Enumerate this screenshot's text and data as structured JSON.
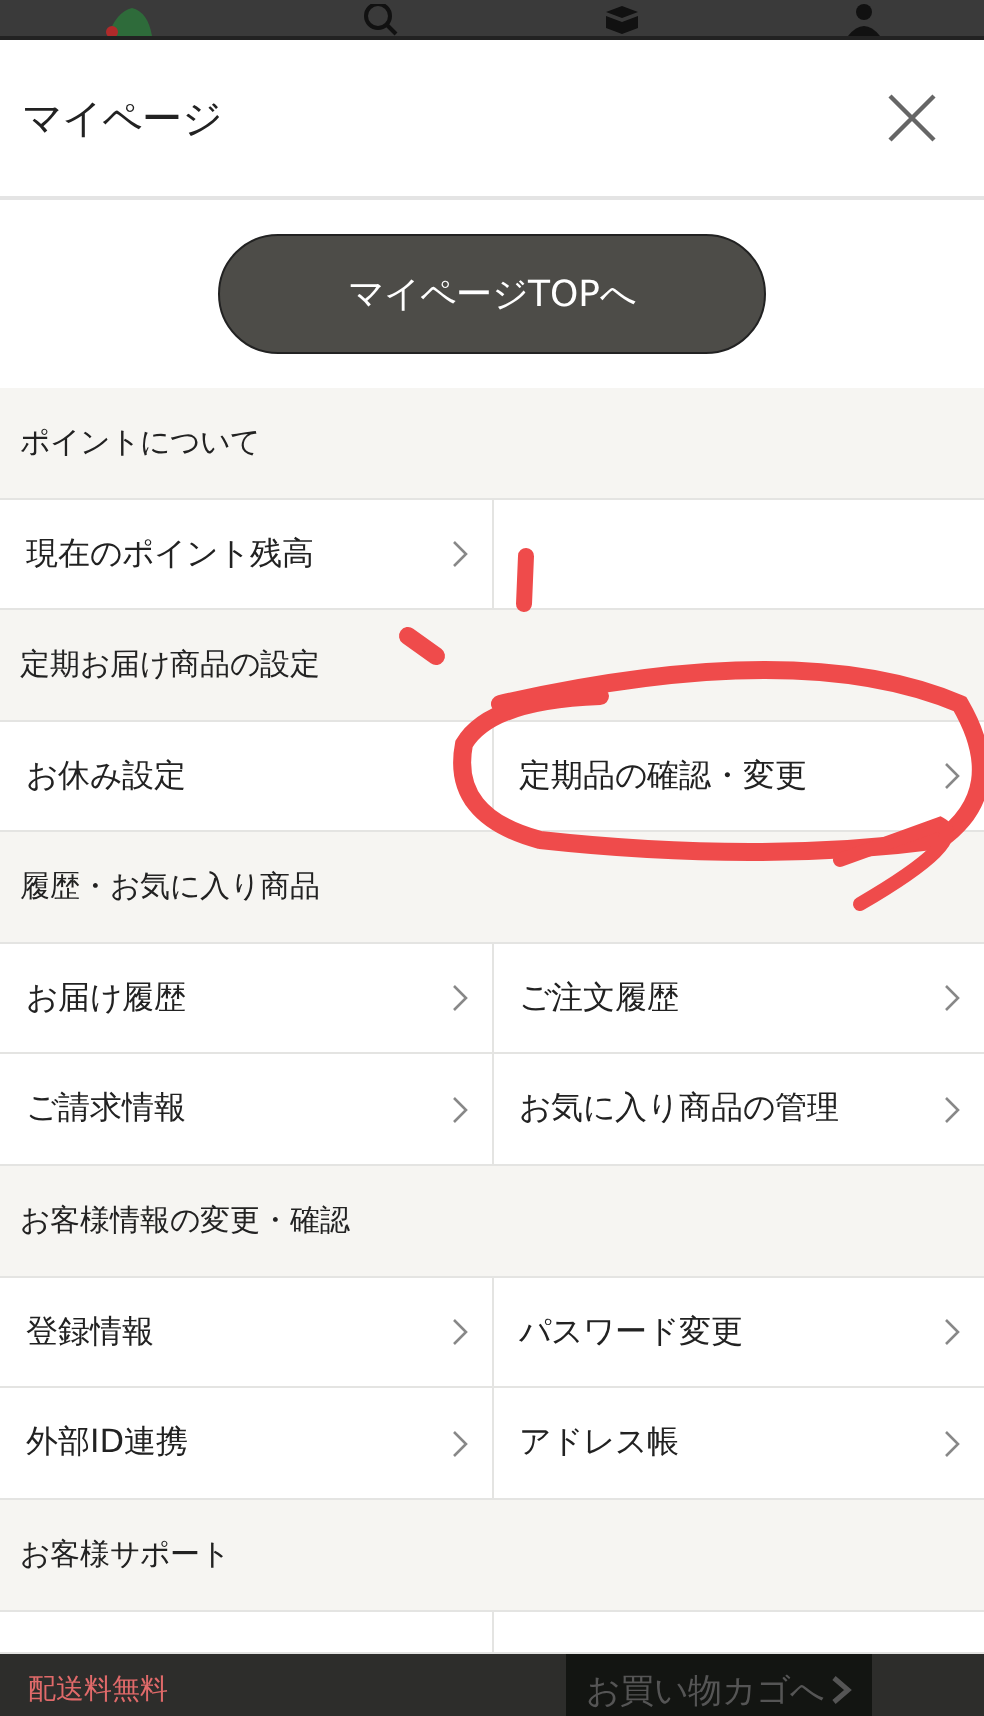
{
  "title": "マイページ",
  "top_button": "マイページTOPへ",
  "sections": [
    {
      "title": "ポイントについて",
      "rows": [
        [
          {
            "kind": "link",
            "label": "現在のポイント残高",
            "chevron": true
          },
          {
            "kind": "empty"
          }
        ]
      ]
    },
    {
      "title": "定期お届け商品の設定",
      "rows": [
        [
          {
            "kind": "link",
            "label": "お休み設定",
            "chevron": false
          },
          {
            "kind": "link",
            "label": "定期品の確認・変更",
            "chevron": true
          }
        ]
      ]
    },
    {
      "title": "履歴・お気に入り商品",
      "rows": [
        [
          {
            "kind": "link",
            "label": "お届け履歴",
            "chevron": true
          },
          {
            "kind": "link",
            "label": "ご注文履歴",
            "chevron": true
          }
        ],
        [
          {
            "kind": "link",
            "label": "ご請求情報",
            "chevron": true
          },
          {
            "kind": "link",
            "label": "お気に入り商品の管理",
            "chevron": true
          }
        ]
      ]
    },
    {
      "title": "お客様情報の変更・確認",
      "rows": [
        [
          {
            "kind": "link",
            "label": "登録情報",
            "chevron": true
          },
          {
            "kind": "link",
            "label": "パスワード変更",
            "chevron": true
          }
        ],
        [
          {
            "kind": "link",
            "label": "外部ID連携",
            "chevron": true
          },
          {
            "kind": "link",
            "label": "アドレス帳",
            "chevron": true
          }
        ]
      ]
    },
    {
      "title": "お客様サポート",
      "rows": [
        [
          {
            "kind": "empty"
          },
          {
            "kind": "empty"
          }
        ]
      ]
    }
  ],
  "footer": {
    "shipping": "配送料無料",
    "cart_button": "お買い物カゴへ"
  }
}
